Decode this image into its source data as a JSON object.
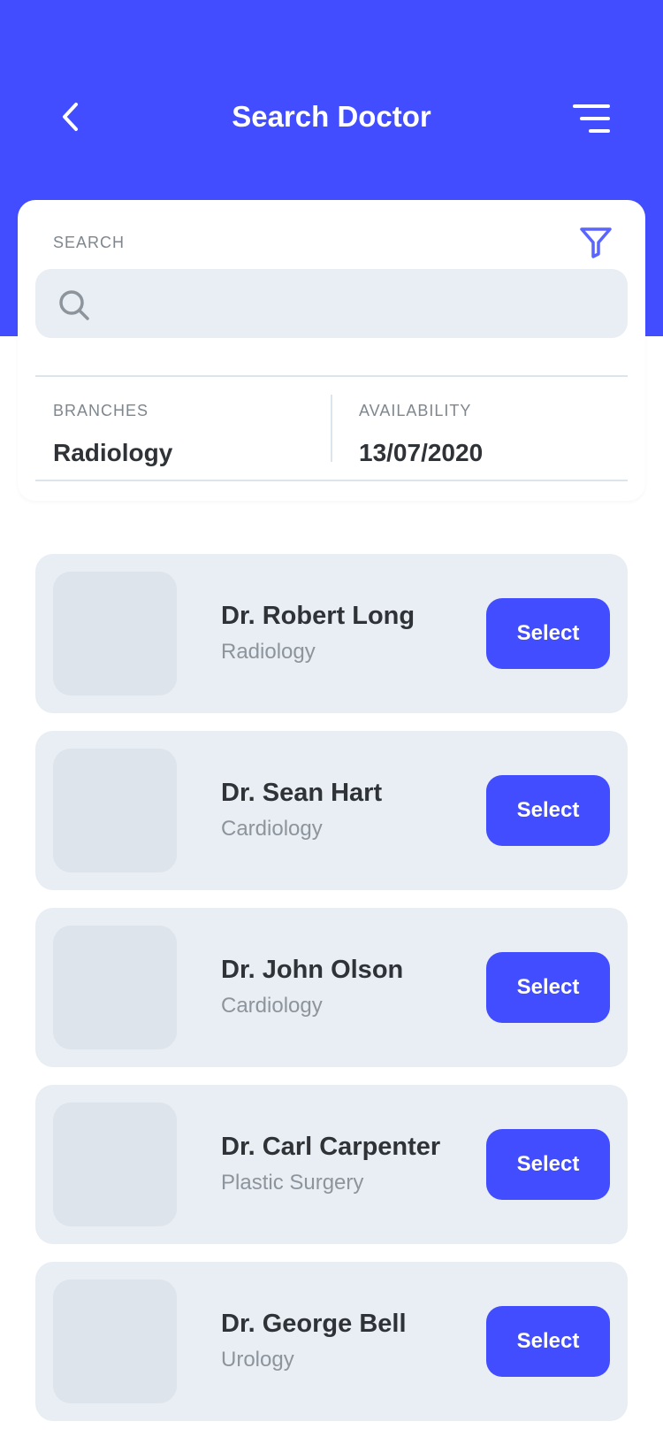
{
  "header": {
    "title": "Search Doctor",
    "background_color": "#424DFF",
    "back_icon": "chevron-left-icon",
    "menu_icon": "menu-icon"
  },
  "search": {
    "label": "SEARCH",
    "value": "",
    "placeholder": "",
    "filter_icon": "filter-icon",
    "search_icon": "search-icon"
  },
  "filters": {
    "branches": {
      "label": "BRANCHES",
      "value": "Radiology"
    },
    "availability": {
      "label": "AVAILABILITY",
      "value": "13/07/2020"
    }
  },
  "doctors": [
    {
      "name": "Dr. Robert Long",
      "specialty": "Radiology",
      "action": "Select"
    },
    {
      "name": "Dr. Sean Hart",
      "specialty": "Cardiology",
      "action": "Select"
    },
    {
      "name": "Dr. John Olson",
      "specialty": "Cardiology",
      "action": "Select"
    },
    {
      "name": "Dr. Carl Carpenter",
      "specialty": "Plastic Surgery",
      "action": "Select"
    },
    {
      "name": "Dr. George Bell",
      "specialty": "Urology",
      "action": "Select"
    }
  ],
  "colors": {
    "accent": "#424DFF",
    "card_background": "#E8EEF3",
    "avatar_placeholder": "#DDE4EC",
    "text_primary": "#2F3337",
    "text_secondary": "#8D949B"
  }
}
